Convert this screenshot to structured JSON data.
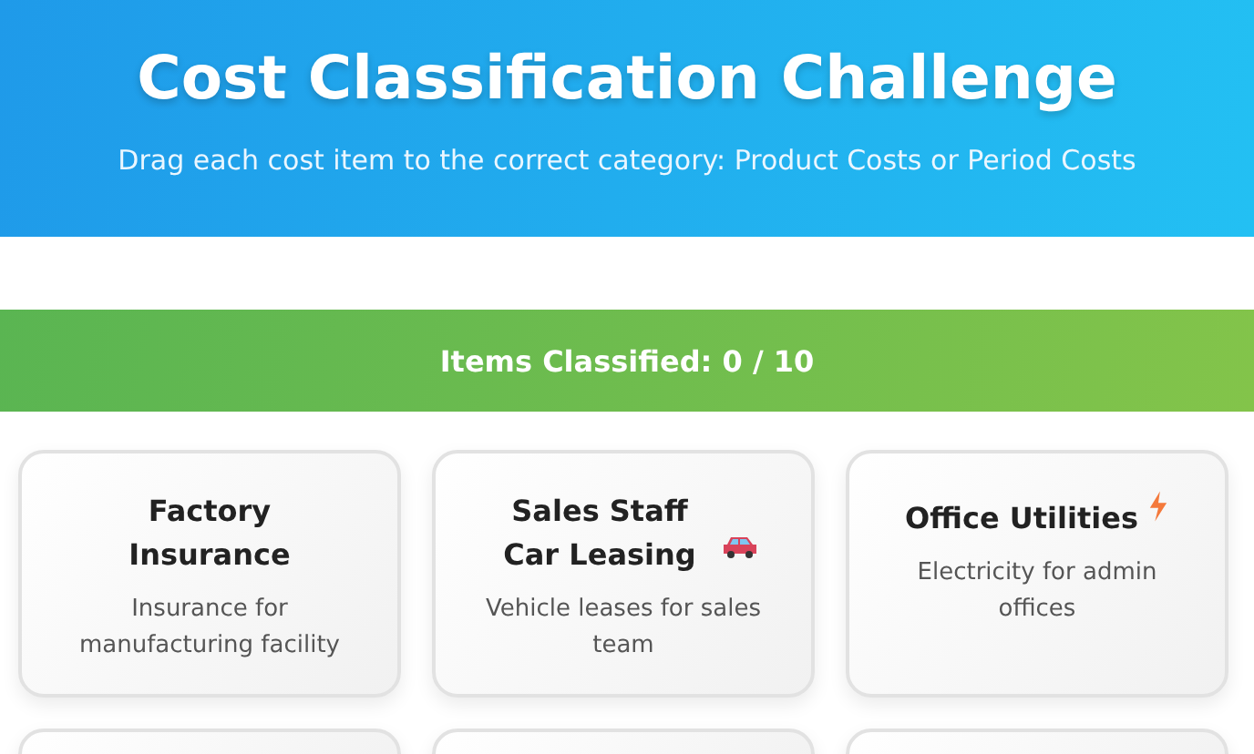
{
  "header": {
    "title": "Cost Classification Challenge",
    "subtitle": "Drag each cost item to the correct category: Product Costs or Period Costs"
  },
  "progress": {
    "text": "Items Classified: 0 / 10"
  },
  "items": [
    {
      "kind": "plain",
      "title": "Factory Insurance",
      "description": "Insurance for manufacturing facility"
    },
    {
      "kind": "car",
      "title": "Sales Staff Car Leasing",
      "description": "Vehicle leases for sales team"
    },
    {
      "kind": "bolt",
      "title": "Office Utilities",
      "description": "Electricity for admin offices"
    },
    {
      "kind": "cut"
    },
    {
      "kind": "cut"
    },
    {
      "kind": "cut"
    }
  ]
}
